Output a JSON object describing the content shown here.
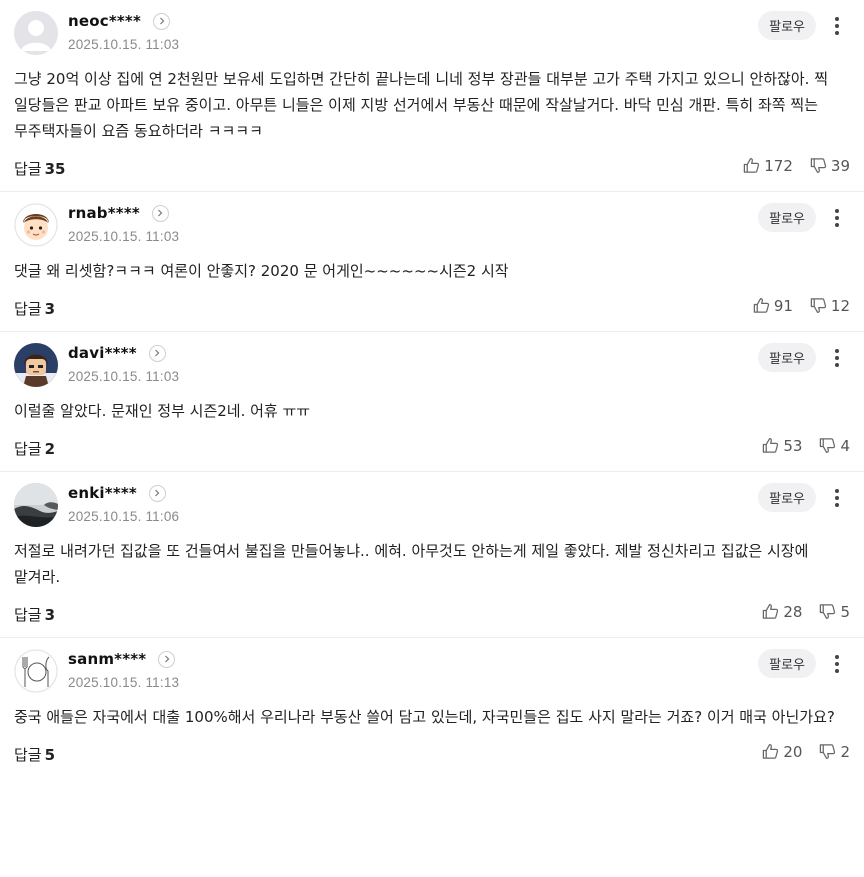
{
  "follow_label": "팔로우",
  "reply_label": "답글",
  "comments": [
    {
      "nickname": "neoc****",
      "date": "2025.10.15. 11:03",
      "text": "그냥 20억 이상 집에 연 2천원만 보유세 도입하면 간단히 끝나는데 니네 정부 장관들 대부분 고가 주택 가지고 있으니 안하잖아. 찍 일당들은 판교 아파트 보유 중이고. 아무튼 니들은 이제 지방 선거에서 부동산 때문에 작살날거다. 바닥 민심 개판. 특히 좌쪽 찍는 무주택자들이 요즘 동요하더라 ㅋㅋㅋㅋ",
      "replies": "35",
      "likes": "172",
      "dislikes": "39",
      "avatar": "default-user-icon"
    },
    {
      "nickname": "rnab****",
      "date": "2025.10.15. 11:03",
      "text": "댓글 왜 리셋함?ㅋㅋㅋ 여론이 안좋지? 2020 문 어게인~~~~~~시즌2 시작",
      "replies": "3",
      "likes": "91",
      "dislikes": "12",
      "avatar": "cartoon-face-icon"
    },
    {
      "nickname": "davi****",
      "date": "2025.10.15. 11:03",
      "text": "이럴줄 알았다. 문재인 정부 시즌2네. 어휴 ㅠㅠ",
      "replies": "2",
      "likes": "53",
      "dislikes": "4",
      "avatar": "pixel-character-icon"
    },
    {
      "nickname": "enki****",
      "date": "2025.10.15. 11:06",
      "text": "저절로 내려가던 집값을 또 건들여서 불집을 만들어놓냐.. 에혀. 아무것도 안하는게 제일 좋았다. 제발 정신차리고 집값은 시장에 맡겨라.",
      "replies": "3",
      "likes": "28",
      "dislikes": "5",
      "avatar": "landscape-photo-icon"
    },
    {
      "nickname": "sanm****",
      "date": "2025.10.15. 11:13",
      "text": "중국 애들은 자국에서 대출 100%해서 우리나라 부동산 쓸어 담고 있는데, 자국민들은 집도 사지 말라는 거죠? 이거 매국 아닌가요?",
      "replies": "5",
      "likes": "20",
      "dislikes": "2",
      "avatar": "cutlery-sketch-icon"
    }
  ]
}
